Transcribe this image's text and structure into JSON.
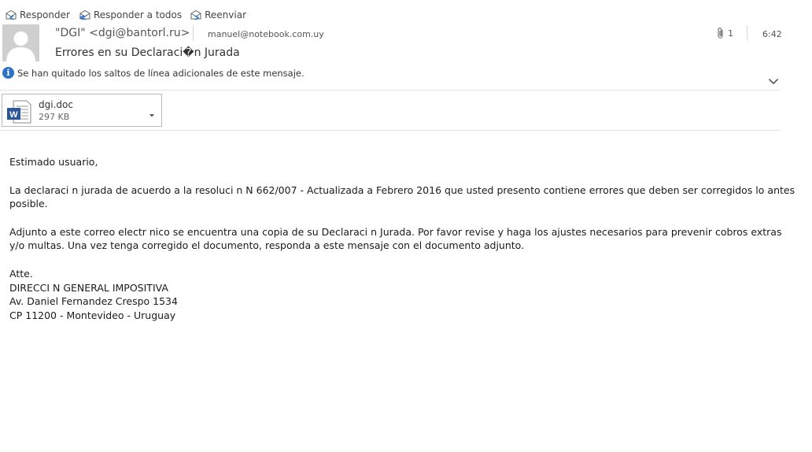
{
  "toolbar": {
    "reply_label": "Responder",
    "reply_all_label": "Responder a todos",
    "forward_label": "Reenviar"
  },
  "message": {
    "from": "\"DGI\" <dgi@bantorl.ru>",
    "to": "manuel@notebook.com.uy",
    "subject": "Errores en su Declaraci�n Jurada",
    "attachment_count": "1",
    "time": "6:42",
    "info_notice": "Se han quitado los saltos de línea adicionales de este mensaje."
  },
  "attachment": {
    "name": "dgi.doc",
    "size": "297 KB"
  },
  "body": {
    "greeting": "Estimado usuario,",
    "paragraph1": "La declaraci n jurada de acuerdo a la resoluci n N  662/007 - Actualizada a Febrero 2016 que usted presento contiene errores que deben ser corregidos lo antes posible.",
    "paragraph2": "Adjunto a este correo electr nico se encuentra una copia de su Declaraci n Jurada. Por favor revise y haga los ajustes necesarios para prevenir cobros extras y/o multas. Una vez tenga corregido el documento, responda a este mensaje con el documento adjunto.",
    "sign_line1": "Atte.",
    "sign_line2": "DIRECCI N GENERAL IMPOSITIVA",
    "sign_line3": "Av. Daniel Fernandez Crespo 1534",
    "sign_line4": "CP 11200 - Montevideo - Uruguay"
  },
  "colors": {
    "info_icon": "#2c72c7",
    "word_icon": "#2b579a"
  },
  "icons": [
    "reply-icon",
    "reply-all-icon",
    "forward-icon",
    "avatar-icon",
    "paperclip-icon",
    "info-icon",
    "chevron-down-icon",
    "word-doc-icon",
    "dropdown-arrow-icon"
  ]
}
